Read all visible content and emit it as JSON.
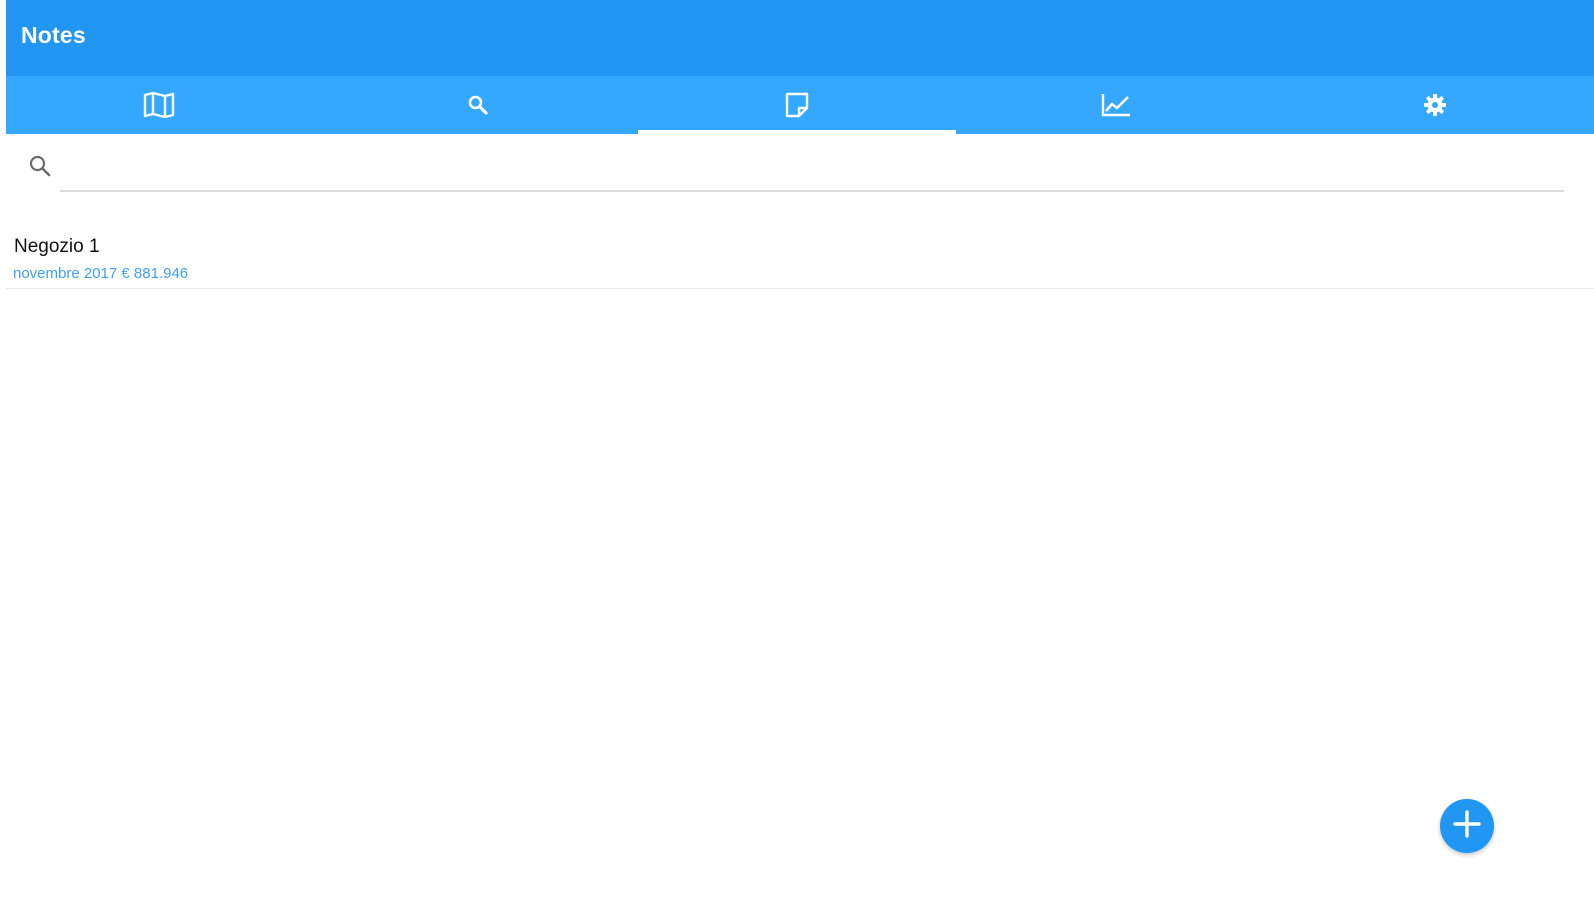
{
  "appbar": {
    "title": "Notes",
    "color": "#2196f3"
  },
  "tabs": [
    {
      "icon": "map-icon",
      "active": false
    },
    {
      "icon": "search-icon",
      "active": false
    },
    {
      "icon": "note-icon",
      "active": true
    },
    {
      "icon": "chart-icon",
      "active": false
    },
    {
      "icon": "gear-icon",
      "active": false
    }
  ],
  "tabbar_color": "#34a8ff",
  "search": {
    "icon": "search-icon",
    "value": "",
    "placeholder": ""
  },
  "notes": [
    {
      "title": "Negozio 1",
      "subtitle": "novembre 2017 € 881.946"
    }
  ],
  "fab": {
    "icon": "plus-icon",
    "color": "#2196f3"
  }
}
